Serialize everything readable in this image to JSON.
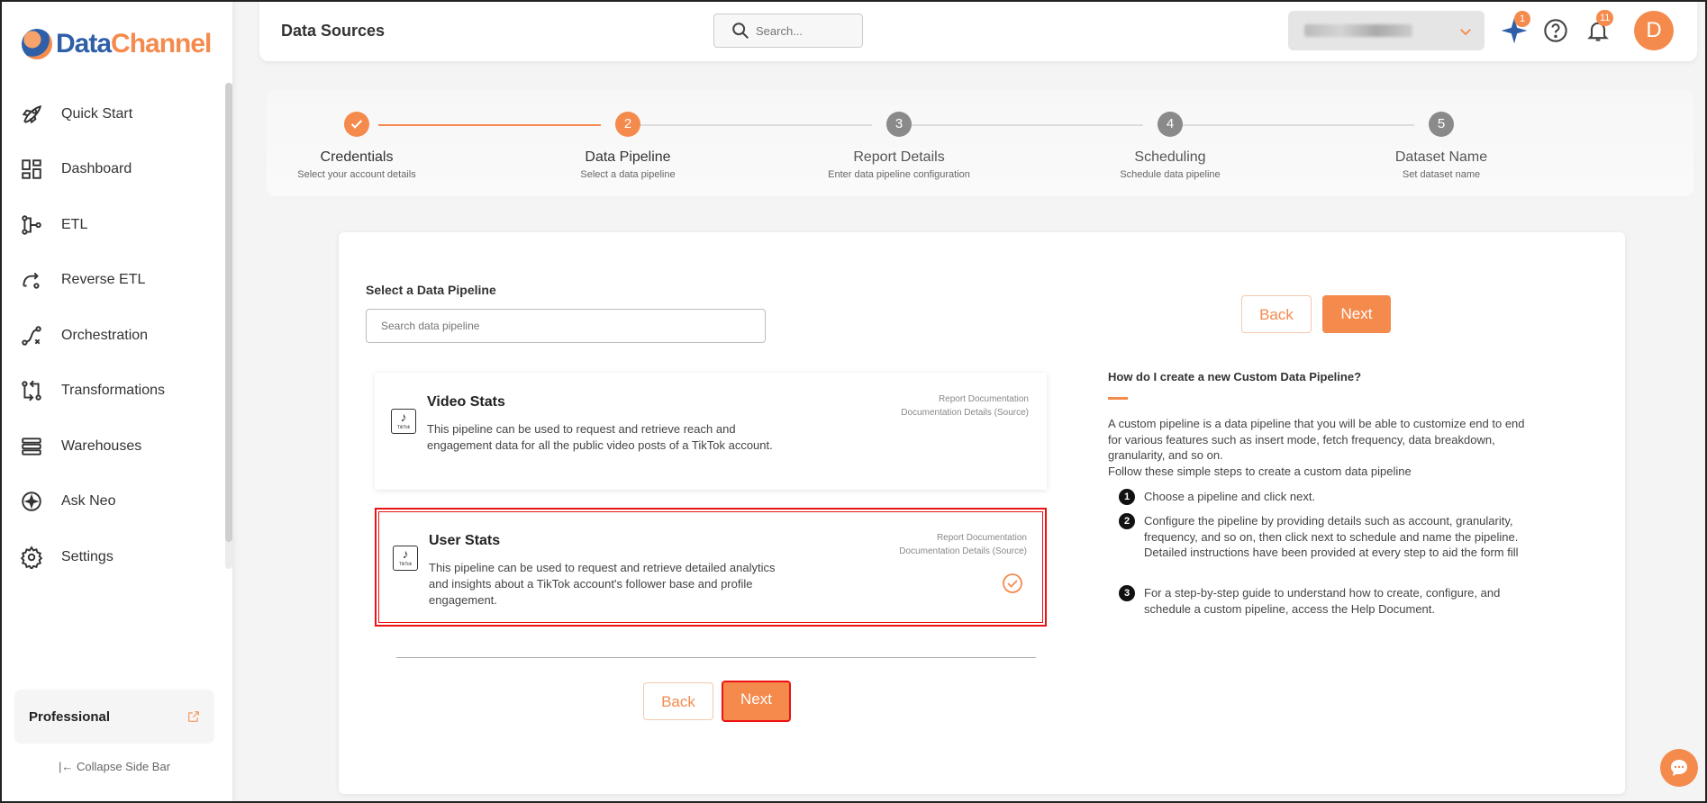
{
  "brand": {
    "part1": "Data",
    "part2": "Channel"
  },
  "sidebar": {
    "items": [
      {
        "label": "Quick Start",
        "icon": "rocket-icon"
      },
      {
        "label": "Dashboard",
        "icon": "dashboard-icon"
      },
      {
        "label": "ETL",
        "icon": "etl-icon"
      },
      {
        "label": "Reverse ETL",
        "icon": "reverse-etl-icon"
      },
      {
        "label": "Orchestration",
        "icon": "orchestration-icon"
      },
      {
        "label": "Transformations",
        "icon": "transformations-icon"
      },
      {
        "label": "Warehouses",
        "icon": "warehouses-icon"
      },
      {
        "label": "Ask Neo",
        "icon": "ask-neo-icon"
      },
      {
        "label": "Settings",
        "icon": "gear-icon"
      }
    ],
    "plan": "Professional",
    "collapse": "Collapse Side Bar"
  },
  "header": {
    "title": "Data Sources",
    "search_placeholder": "Search...",
    "ai_badge": "1",
    "notif_badge": "11",
    "avatar_initial": "D"
  },
  "stepper": [
    {
      "title": "Credentials",
      "sub": "Select your account details",
      "state": "done",
      "num": "1"
    },
    {
      "title": "Data Pipeline",
      "sub": "Select a data pipeline",
      "state": "active",
      "num": "2"
    },
    {
      "title": "Report Details",
      "sub": "Enter data pipeline configuration",
      "state": "pending",
      "num": "3"
    },
    {
      "title": "Scheduling",
      "sub": "Schedule data pipeline",
      "state": "pending",
      "num": "4"
    },
    {
      "title": "Dataset Name",
      "sub": "Set dataset name",
      "state": "pending",
      "num": "5"
    }
  ],
  "main": {
    "select_label": "Select a Data Pipeline",
    "search_placeholder": "Search data pipeline",
    "pipelines": [
      {
        "title": "Video Stats",
        "desc": "This pipeline can be used to request and retrieve reach and engagement data for all the public video posts of a TikTok account.",
        "link1": "Report Documentation",
        "link2": "Documentation Details (Source)",
        "selected": false
      },
      {
        "title": "User Stats",
        "desc": "This pipeline can be used to request and retrieve detailed analytics and insights about a TikTok account's follower base and profile engagement.",
        "link1": "Report Documentation",
        "link2": "Documentation Details (Source)",
        "selected": true
      }
    ],
    "back_label": "Back",
    "next_label": "Next",
    "tiktok_label": "TikTok"
  },
  "help": {
    "title": "How do I create a new Custom Data Pipeline?",
    "intro": "A custom pipeline is a data pipeline that you will be able to customize end to end for various features such as insert mode, fetch frequency, data breakdown, granularity, and so on.",
    "follow": "Follow these simple steps to create a custom data pipeline",
    "steps": [
      {
        "num": "1",
        "text": "Choose a pipeline and click next."
      },
      {
        "num": "2",
        "text": "Configure the pipeline by providing details such as account, granularity, frequency, and so on, then click next to schedule and name the pipeline. Detailed instructions have been provided at every step to aid the form fill"
      },
      {
        "num": "3",
        "text": "For a step-by-step guide to understand how to create, configure, and schedule a custom pipeline, access the Help Document."
      }
    ]
  },
  "colors": {
    "accent": "#f58a4d",
    "brand_blue": "#2f5fa8",
    "highlight": "#e11111"
  }
}
